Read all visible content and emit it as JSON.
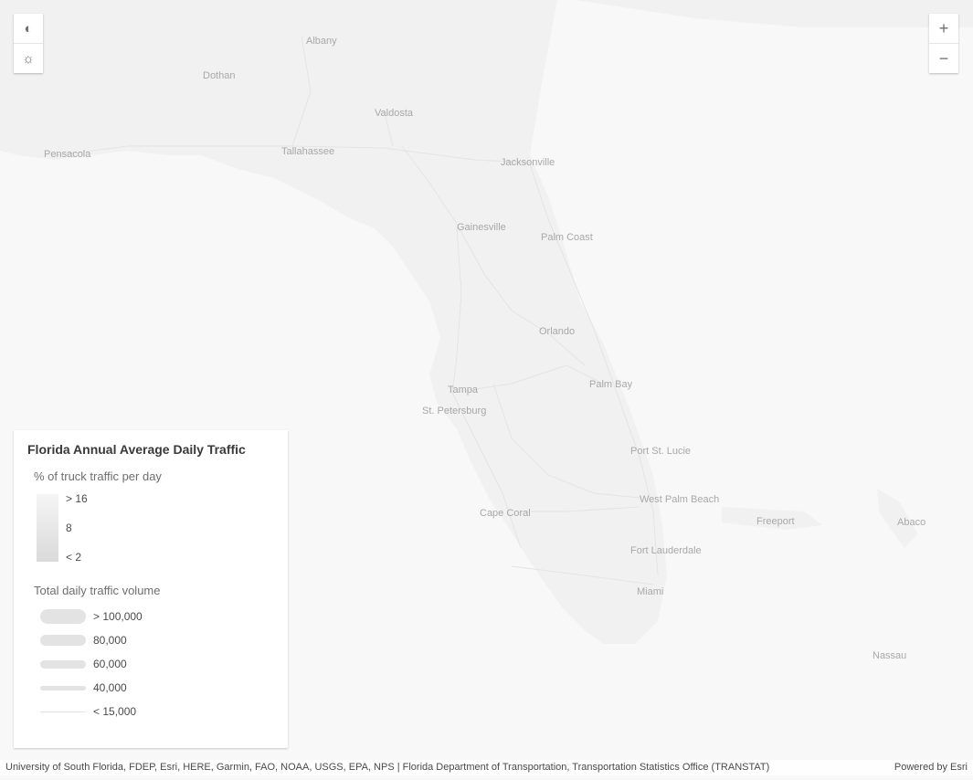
{
  "map": {
    "places": [
      {
        "name": "Albany"
      },
      {
        "name": "Dothan"
      },
      {
        "name": "Valdosta"
      },
      {
        "name": "Tallahassee"
      },
      {
        "name": "Pensacola"
      },
      {
        "name": "Jacksonville"
      },
      {
        "name": "Gainesville"
      },
      {
        "name": "Palm Coast"
      },
      {
        "name": "Orlando"
      },
      {
        "name": "Tampa"
      },
      {
        "name": "St. Petersburg"
      },
      {
        "name": "Palm Bay"
      },
      {
        "name": "Port St. Lucie"
      },
      {
        "name": "West Palm Beach"
      },
      {
        "name": "Cape Coral"
      },
      {
        "name": "Fort Lauderdale"
      },
      {
        "name": "Miami"
      },
      {
        "name": "Freeport"
      },
      {
        "name": "Abaco"
      },
      {
        "name": "Nassau"
      }
    ]
  },
  "controls": {
    "left": [
      {
        "icon": "layers-icon",
        "glyph": "◐"
      },
      {
        "icon": "sun-icon",
        "glyph": "☼"
      }
    ],
    "zoom_in": "+",
    "zoom_out": "−"
  },
  "legend": {
    "title": "Florida Annual Average Daily Traffic",
    "color_section": {
      "title": "% of truck traffic per day",
      "stops": [
        {
          "label": "> 16",
          "value": 16
        },
        {
          "label": "8",
          "value": 8
        },
        {
          "label": "< 2",
          "value": 2
        }
      ],
      "ramp_colors": [
        "#f5f5f5",
        "#dadada"
      ]
    },
    "size_section": {
      "title": "Total daily traffic volume",
      "stops": [
        {
          "label": "> 100,000",
          "value": 100000
        },
        {
          "label": "80,000",
          "value": 80000
        },
        {
          "label": "60,000",
          "value": 60000
        },
        {
          "label": "40,000",
          "value": 40000
        },
        {
          "label": "< 15,000",
          "value": 15000
        }
      ]
    }
  },
  "attribution": {
    "text": "University of South Florida, FDEP, Esri, HERE, Garmin, FAO, NOAA, USGS, EPA, NPS | Florida Department of Transportation, Transportation Statistics Office (TRANSTAT)",
    "powered_by": "Powered by Esri"
  }
}
